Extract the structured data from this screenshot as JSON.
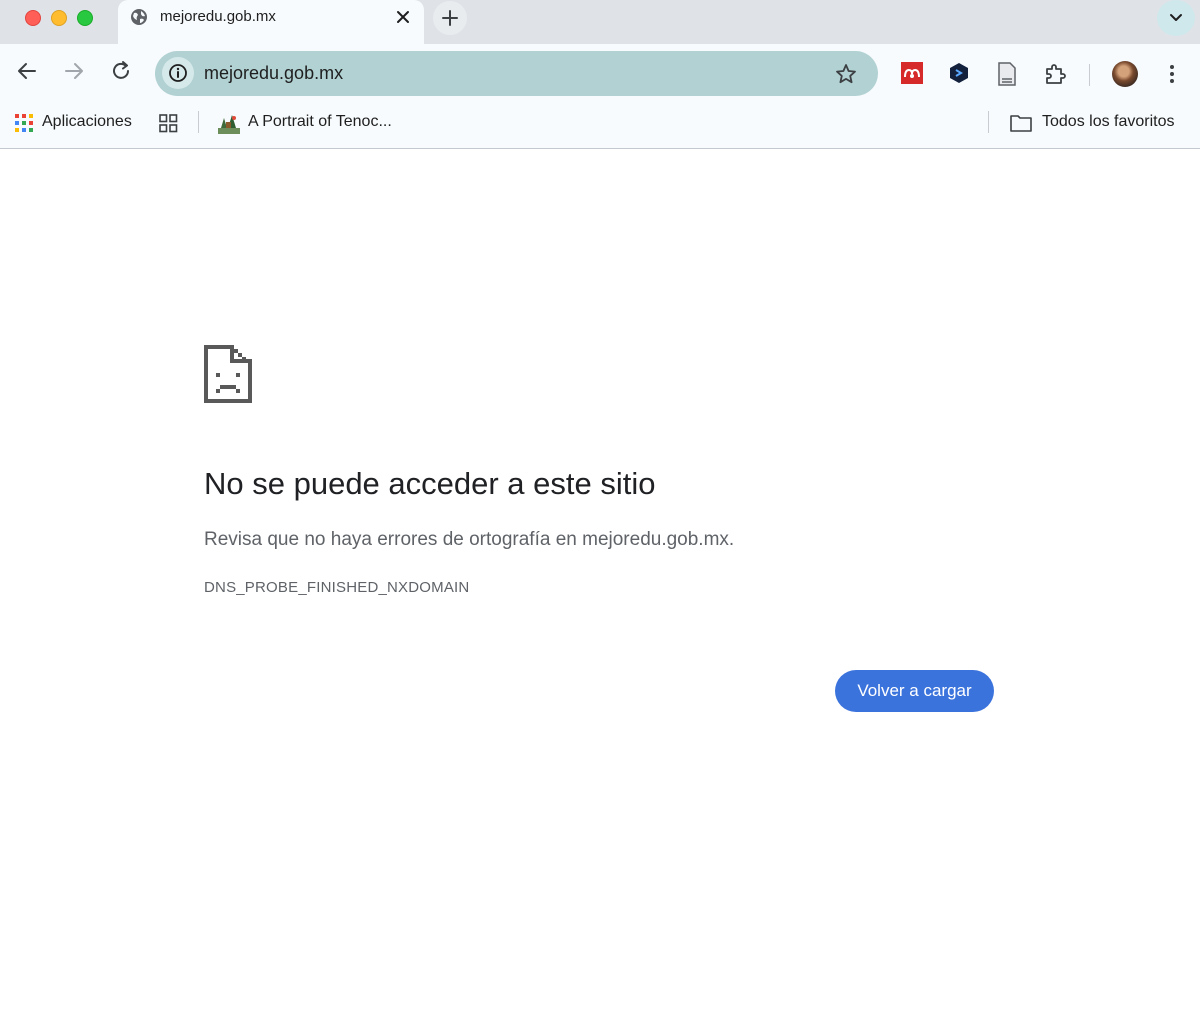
{
  "window": {
    "colors": {
      "close": "#ff5f57",
      "minimize": "#febc2e",
      "maximize": "#28c840"
    }
  },
  "tabs": [
    {
      "title": "mejoredu.gob.mx",
      "icon": "globe-icon",
      "active": true
    }
  ],
  "toolbar": {
    "url": "mejoredu.gob.mx",
    "icons": [
      "back-arrow-icon",
      "forward-arrow-icon",
      "reload-icon",
      "site-info-icon",
      "star-icon",
      "mendeley-icon",
      "extension-dark-icon",
      "document-icon",
      "puzzle-icon",
      "avatar",
      "more-vert-icon"
    ]
  },
  "bookmarks": {
    "apps_label": "Aplicaciones",
    "portrait_label": "A Portrait of Tenoc...",
    "all_bookmarks_label": "Todos los favoritos"
  },
  "error": {
    "icon": "sad-document-icon",
    "title": "No se puede acceder a este sitio",
    "description": "Revisa que no haya errores de ortografía en mejoredu.gob.mx.",
    "code": "DNS_PROBE_FINISHED_NXDOMAIN",
    "reload_label": "Volver a cargar",
    "button_color": "#3b73dd"
  }
}
